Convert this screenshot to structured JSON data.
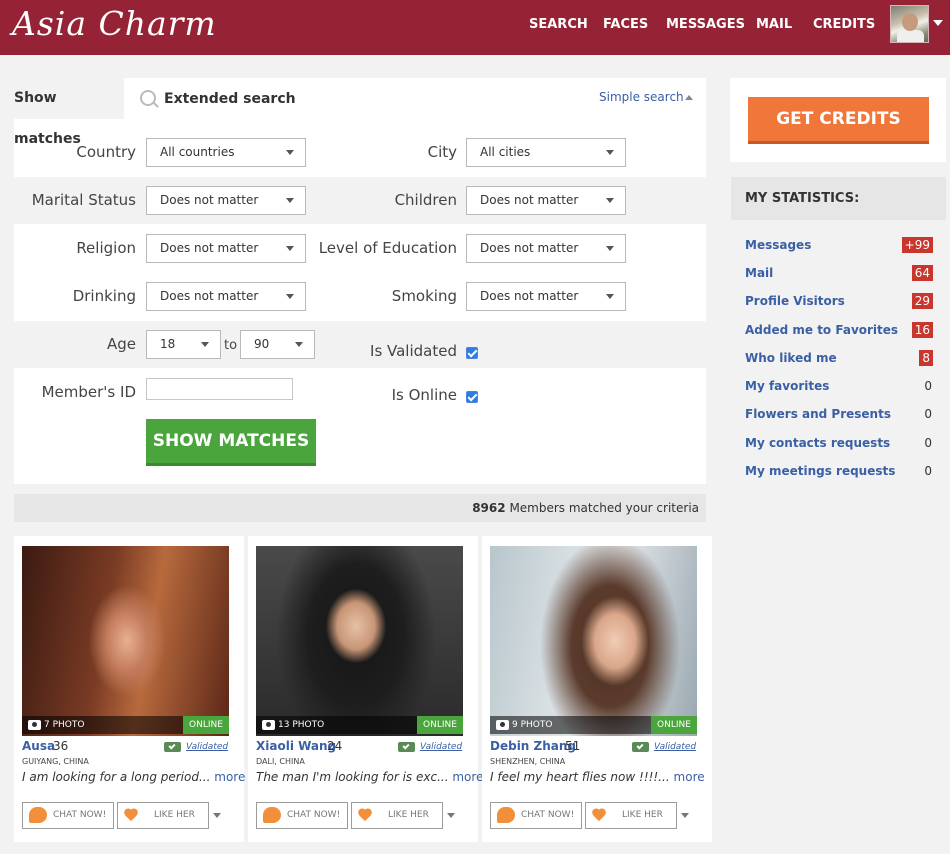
{
  "header": {
    "logo": "Asia Charm",
    "nav": [
      {
        "label": "SEARCH"
      },
      {
        "label": "FACES"
      },
      {
        "label": "MESSAGES"
      },
      {
        "label": "MAIL"
      },
      {
        "label": "CREDITS"
      }
    ],
    "brand_color": "#962335"
  },
  "search": {
    "tab_show": "Show matches",
    "tab_extended": "Extended search",
    "simple_link": "Simple search",
    "fields": {
      "country": {
        "label": "Country",
        "value": "All countries"
      },
      "city": {
        "label": "City",
        "value": "All cities"
      },
      "marital": {
        "label": "Marital Status",
        "value": "Does not matter"
      },
      "children": {
        "label": "Children",
        "value": "Does not matter"
      },
      "religion": {
        "label": "Religion",
        "value": "Does not matter"
      },
      "education": {
        "label": "Level of Education",
        "value": "Does not matter"
      },
      "drinking": {
        "label": "Drinking",
        "value": "Does not matter"
      },
      "smoking": {
        "label": "Smoking",
        "value": "Does not matter"
      },
      "age": {
        "label": "Age",
        "from": "18",
        "to_label": "to",
        "to": "90"
      },
      "validated": {
        "label": "Is Validated",
        "checked": true
      },
      "online": {
        "label": "Is Online",
        "checked": true
      },
      "member_id": {
        "label": "Member's ID",
        "value": ""
      }
    },
    "submit": "SHOW MATCHES"
  },
  "results": {
    "count": "8962",
    "count_text": "Members matched your criteria"
  },
  "members": [
    {
      "name": "Ausa",
      "age": "36",
      "city": "GUIYANG, CHINA",
      "photos": "7 PHOTO",
      "status": "ONLINE",
      "validated": "Validated",
      "desc": "I am looking for a long period...",
      "more": "more",
      "chat": "CHAT NOW!",
      "like": "LIKE HER"
    },
    {
      "name": "Xiaoli Wang",
      "age": "24",
      "city": "DALI, CHINA",
      "photos": "13 PHOTO",
      "status": "ONLINE",
      "validated": "Validated",
      "desc": "The man I'm looking for is exc...",
      "more": "more",
      "chat": "CHAT NOW!",
      "like": "LIKE HER"
    },
    {
      "name": "Debin Zhang",
      "age": "51",
      "city": "SHENZHEN, CHINA",
      "photos": "9 PHOTO",
      "status": "ONLINE",
      "validated": "Validated",
      "desc": "I feel my heart flies now !!!!...",
      "more": "more",
      "chat": "CHAT NOW!",
      "like": "LIKE HER"
    }
  ],
  "sidebar": {
    "credits_button": "GET CREDITS",
    "stats_title": "MY STATISTICS:",
    "stats": [
      {
        "label": "Messages",
        "value": "+99",
        "highlight": true
      },
      {
        "label": "Mail",
        "value": "64",
        "highlight": true
      },
      {
        "label": "Profile Visitors",
        "value": "29",
        "highlight": true
      },
      {
        "label": "Added me to Favorites",
        "value": "16",
        "highlight": true
      },
      {
        "label": "Who liked me",
        "value": "8",
        "highlight": true
      },
      {
        "label": "My favorites",
        "value": "0",
        "highlight": false
      },
      {
        "label": "Flowers and Presents",
        "value": "0",
        "highlight": false
      },
      {
        "label": "My contacts requests",
        "value": "0",
        "highlight": false
      },
      {
        "label": "My meetings requests",
        "value": "0",
        "highlight": false
      }
    ]
  },
  "colors": {
    "accent_green": "#4aa53d",
    "credits_orange": "#f0763a",
    "badge_red": "#c9362d",
    "link_blue": "#3a5fa4"
  }
}
